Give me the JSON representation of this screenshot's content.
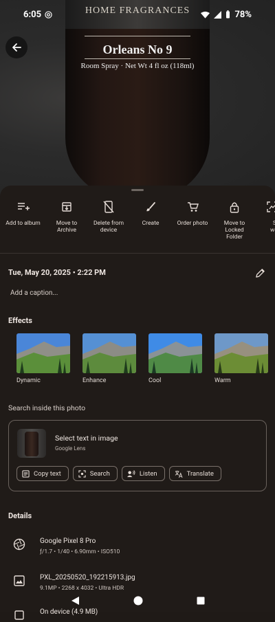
{
  "status": {
    "time": "6:05",
    "battery": "78%"
  },
  "photo": {
    "brand_text": "HOME FRAGRANCES",
    "product_name": "Orleans No 9",
    "product_sub": "Room Spray · Net Wt 4 fl oz (118ml)"
  },
  "actions": [
    {
      "label": "Add to album",
      "icon": "add-to-album-icon"
    },
    {
      "label": "Move to Archive",
      "icon": "archive-icon"
    },
    {
      "label": "Delete from device",
      "icon": "delete-device-icon"
    },
    {
      "label": "Create",
      "icon": "brush-icon"
    },
    {
      "label": "Order photo",
      "icon": "cart-icon"
    },
    {
      "label": "Move to Locked Folder",
      "icon": "lock-icon"
    },
    {
      "label": "Set wallp",
      "icon": "wallpaper-icon"
    }
  ],
  "date": "Tue, May 20, 2025 • 2:22 PM",
  "caption_placeholder": "Add a caption...",
  "effects": {
    "title": "Effects",
    "items": [
      "Dynamic",
      "Enhance",
      "Cool",
      "Warm"
    ]
  },
  "search": {
    "title": "Search inside this photo",
    "lens_title": "Select text in image",
    "lens_sub": "Google Lens",
    "chips": [
      "Copy text",
      "Search",
      "Listen",
      "Translate"
    ]
  },
  "details": {
    "title": "Details",
    "camera": {
      "name": "Google Pixel 8 Pro",
      "specs": "ƒ/1.7  •  1/40  •  6.90mm  •  ISO510"
    },
    "file": {
      "name": "PXL_20250520_192215913.jpg",
      "specs": "9.1MP  •  2268 x 4032  •  Ultra HDR"
    },
    "next_partial": "On device (4.9 MB)"
  }
}
